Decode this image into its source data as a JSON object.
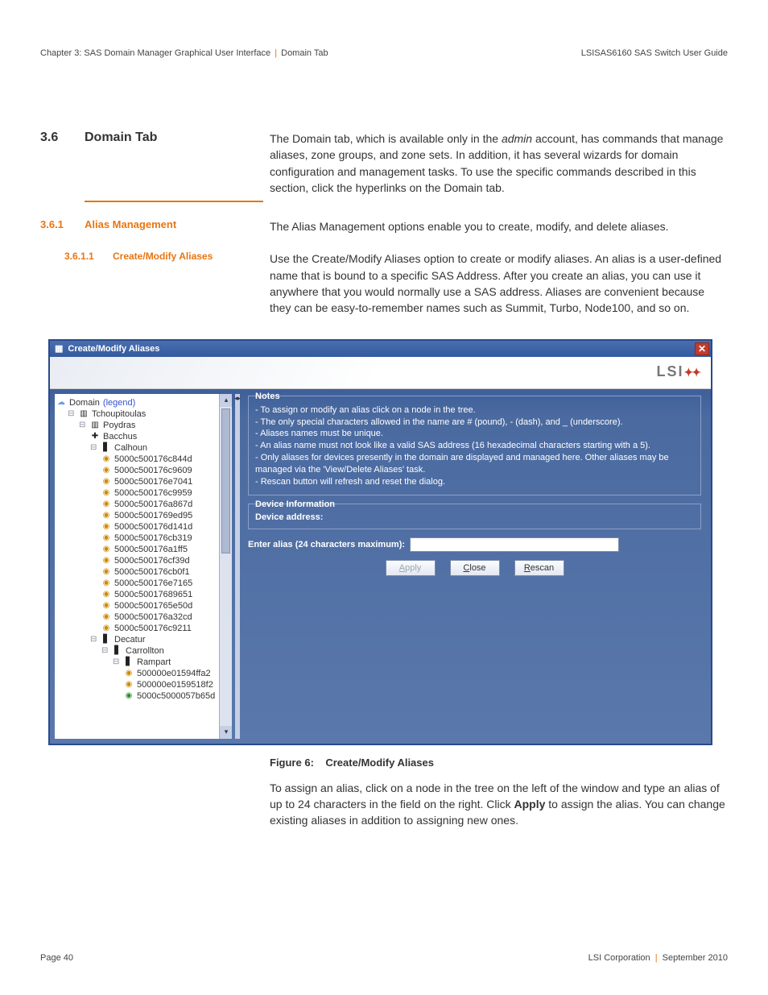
{
  "header": {
    "left_a": "Chapter 3: SAS Domain Manager Graphical User Interface",
    "left_b": "Domain Tab",
    "right": "LSISAS6160 SAS Switch User Guide"
  },
  "s36": {
    "num": "3.6",
    "title": "Domain Tab",
    "body_a": "The Domain tab, which is available only in the ",
    "body_em": "admin",
    "body_b": " account, has commands that manage aliases, zone groups, and zone sets. In addition, it has several wizards for domain configuration and management tasks. To use the specific commands described in this section, click the hyperlinks on the Domain tab."
  },
  "s361": {
    "num": "3.6.1",
    "title": "Alias Management",
    "body": "The Alias Management options enable you to create, modify, and delete aliases."
  },
  "s3611": {
    "num": "3.6.1.1",
    "title": "Create/Modify Aliases",
    "body": "Use the Create/Modify Aliases option to create or modify aliases. An alias is a user-defined name that is bound to a specific SAS Address. After you create an alias, you can use it anywhere that you would normally use a SAS address. Aliases are convenient because they can be easy-to-remember names such as Summit, Turbo, Node100, and so on."
  },
  "shot": {
    "title": "Create/Modify Aliases",
    "lsi": "LSI",
    "tree": {
      "root": "Domain",
      "legend": "(legend)",
      "n1": "Tchoupitoulas",
      "n2": "Poydras",
      "n3": "Bacchus",
      "n4": "Calhoun",
      "devs": [
        "5000c500176c844d",
        "5000c500176c9609",
        "5000c500176e7041",
        "5000c500176c9959",
        "5000c500176a867d",
        "5000c5001769ed95",
        "5000c500176d141d",
        "5000c500176cb319",
        "5000c500176a1ff5",
        "5000c500176cf39d",
        "5000c500176cb0f1",
        "5000c500176e7165",
        "5000c50017689651",
        "5000c5001765e50d",
        "5000c500176a32cd",
        "5000c500176c9211"
      ],
      "n5": "Decatur",
      "n6": "Carrollton",
      "n7": "Rampart",
      "devs2": [
        "500000e01594ffa2",
        "500000e0159518f2",
        "5000c5000057b65d"
      ]
    },
    "notes": {
      "legend": "Notes",
      "l1": "- To assign or modify an alias click on a node in the tree.",
      "l2": "- The only special characters allowed in the name are # (pound), - (dash), and _ (underscore).",
      "l3": "- Aliases names must be unique.",
      "l4": "- An alias name must not look like a valid SAS address (16 hexadecimal characters starting with a 5).",
      "l5": "- Only aliases for devices presently in the domain are displayed and managed here. Other aliases may be managed via the 'View/Delete Aliases' task.",
      "l6": "- Rescan button will refresh and reset the dialog."
    },
    "dev": {
      "legend": "Device Information",
      "addr": "Device address:"
    },
    "alias": {
      "label": "Enter alias (24 characters maximum):"
    },
    "btns": {
      "apply": "Apply",
      "close": "Close",
      "rescan": "Rescan"
    }
  },
  "fig": {
    "label": "Figure 6:",
    "title": "Create/Modify Aliases"
  },
  "para": {
    "a": "To assign an alias, click on a node in the tree on the left of the window and type an alias of up to 24 characters in the field on the right. Click ",
    "b": "Apply",
    "c": " to assign the alias. You can change existing aliases in addition to assigning new ones."
  },
  "footer": {
    "left": "Page 40",
    "right_a": "LSI Corporation",
    "right_b": "September 2010"
  }
}
